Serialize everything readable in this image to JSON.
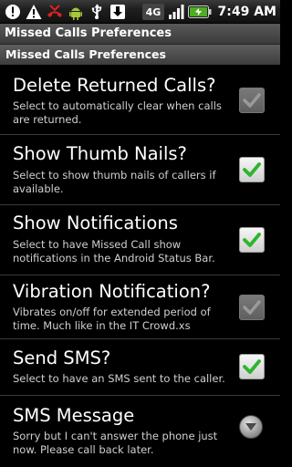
{
  "status_bar": {
    "time": "7:49",
    "ampm": "AM",
    "network": "4G",
    "left_icons": [
      "error-icon",
      "warning-icon",
      "missed-call-icon",
      "android-icon",
      "usb-icon",
      "download-icon"
    ],
    "right_icons": [
      "network-4g-icon",
      "signal-icon",
      "battery-icon"
    ]
  },
  "title_bar": {
    "title": "Missed Calls Preferences"
  },
  "section": {
    "header": "Missed Calls Preferences"
  },
  "preferences": [
    {
      "title": "Delete Returned Calls?",
      "summary": "Select to automatically clear when calls are returned.",
      "widget": "checkbox",
      "checked": true,
      "enabled": false
    },
    {
      "title": "Show Thumb Nails?",
      "summary": "Select to show thumb nails of callers if available.",
      "widget": "checkbox",
      "checked": true,
      "enabled": true
    },
    {
      "title": "Show Notifications",
      "summary": "Select to have Missed Call show notifications in the Android Status Bar.",
      "widget": "checkbox",
      "checked": true,
      "enabled": true
    },
    {
      "title": "Vibration Notification?",
      "summary": "Vibrates on/off for extended period of time. Much like in the IT Crowd.xs",
      "widget": "checkbox",
      "checked": true,
      "enabled": false
    },
    {
      "title": "Send SMS?",
      "summary": "Select to have an SMS sent to the caller.",
      "widget": "checkbox",
      "checked": true,
      "enabled": true
    },
    {
      "title": "SMS Message",
      "summary": "Sorry but I can't answer the phone just now. Please call back later.",
      "widget": "dropdown",
      "enabled": true
    }
  ],
  "colors": {
    "check_enabled": "#2db52d",
    "check_disabled": "#9a9a9a",
    "background": "#000000",
    "summary_text": "#d0d0d0"
  }
}
